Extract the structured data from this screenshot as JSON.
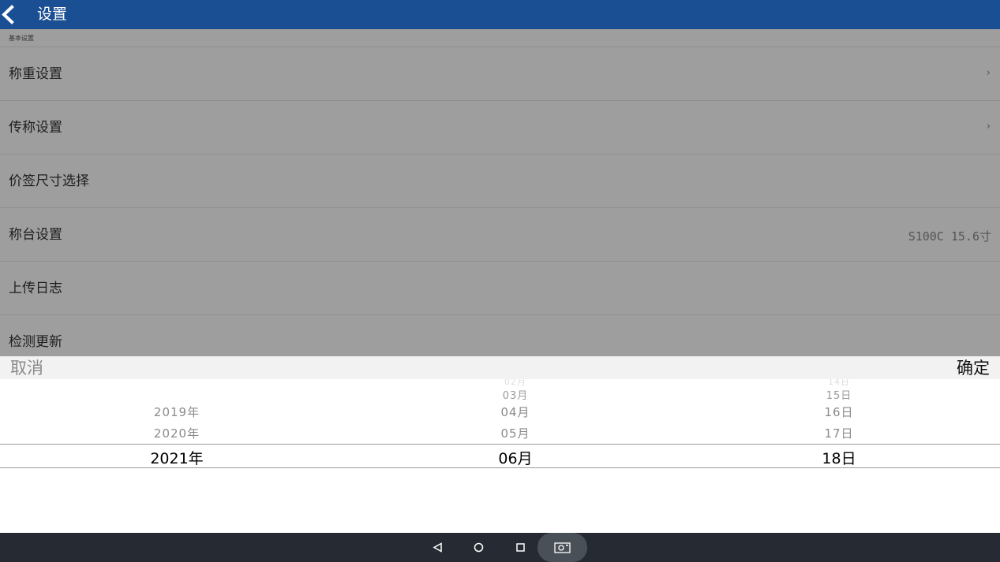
{
  "header": {
    "title": "设置"
  },
  "settings": {
    "section_title": "基本设置",
    "rows": [
      {
        "label": "称重设置",
        "value": "",
        "has_chevron": true
      },
      {
        "label": "传称设置",
        "value": "",
        "has_chevron": true
      },
      {
        "label": "价签尺寸选择",
        "value": "",
        "has_chevron": false
      },
      {
        "label": "称台设置",
        "value": "S100C 15.6寸",
        "has_chevron": false
      },
      {
        "label": "上传日志",
        "value": "",
        "has_chevron": false
      },
      {
        "label": "检测更新",
        "value": "",
        "has_chevron": false
      }
    ],
    "chevron": "›"
  },
  "picker": {
    "cancel_label": "取消",
    "confirm_label": "确定",
    "years": {
      "near_above_2": "2019年",
      "near_above_1": "2020年",
      "selected": "2021年"
    },
    "months": {
      "far_above_3": "02月",
      "far_above_2": "03月",
      "near_above_2": "04月",
      "near_above_1": "05月",
      "selected": "06月"
    },
    "days": {
      "far_above_3": "14日",
      "far_above_2": "15日",
      "near_above_2": "16日",
      "near_above_1": "17日",
      "selected": "18日"
    }
  },
  "navbar": {
    "icons": [
      "back-triangle-icon",
      "home-circle-icon",
      "recents-square-icon",
      "screenshot-camera-icon"
    ]
  },
  "colors": {
    "header_bg": "#1b4f93",
    "overlay_bg": "#9e9e9e",
    "navbar_bg": "#252a33"
  }
}
